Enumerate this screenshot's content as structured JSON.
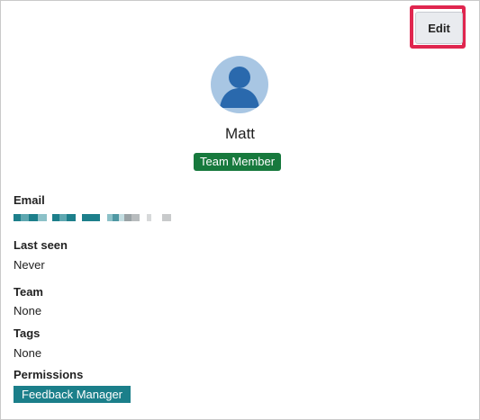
{
  "profile": {
    "edit_label": "Edit",
    "name": "Matt",
    "role": "Team Member",
    "role_color": "#17793d",
    "avatar_icon": "user-avatar-icon",
    "avatar_bg": "#a8c6e3",
    "avatar_fg": "#2a69ad"
  },
  "fields": {
    "email_label": "Email",
    "email_value_redacted": true,
    "last_seen_label": "Last seen",
    "last_seen_value": "Never",
    "team_label": "Team",
    "team_value": "None",
    "tags_label": "Tags",
    "tags_value": "None",
    "permissions_label": "Permissions",
    "permissions": [
      "Feedback Manager"
    ],
    "permission_color": "#1b7f8a"
  },
  "highlight_color": "#e0264f"
}
